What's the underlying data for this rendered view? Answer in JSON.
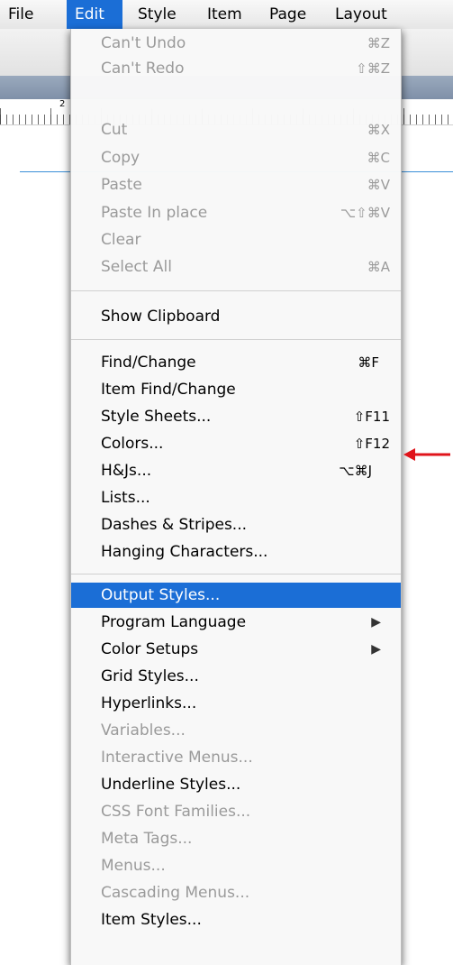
{
  "menubar": {
    "items": [
      {
        "label": "File",
        "active": false
      },
      {
        "label": "Edit",
        "active": true
      },
      {
        "label": "Style",
        "active": false
      },
      {
        "label": "Item",
        "active": false
      },
      {
        "label": "Page",
        "active": false
      },
      {
        "label": "Layout",
        "active": false
      }
    ]
  },
  "ruler": {
    "number": "2"
  },
  "edit_menu": {
    "items": [
      {
        "label": "Can't Undo",
        "shortcut": "⌘Z",
        "enabled": false
      },
      {
        "label": "Can't Redo",
        "shortcut": "⇧⌘Z",
        "enabled": false
      },
      {
        "label": "Cut",
        "shortcut": "⌘X",
        "enabled": false
      },
      {
        "label": "Copy",
        "shortcut": "⌘C",
        "enabled": false
      },
      {
        "label": "Paste",
        "shortcut": "⌘V",
        "enabled": false
      },
      {
        "label": "Paste In place",
        "shortcut": "⌥⇧⌘V",
        "enabled": false
      },
      {
        "label": "Clear",
        "shortcut": "",
        "enabled": false
      },
      {
        "label": "Select All",
        "shortcut": "⌘A",
        "enabled": false
      },
      {
        "label": "Show Clipboard",
        "shortcut": "",
        "enabled": true
      },
      {
        "label": "Find/Change",
        "shortcut": "⌘F",
        "enabled": true
      },
      {
        "label": "Item Find/Change",
        "shortcut": "",
        "enabled": true
      },
      {
        "label": "Style Sheets...",
        "shortcut": "⇧F11",
        "enabled": true
      },
      {
        "label": "Colors...",
        "shortcut": "⇧F12",
        "enabled": true
      },
      {
        "label": "H&Js...",
        "shortcut": "⌥⌘J",
        "enabled": true
      },
      {
        "label": "Lists...",
        "shortcut": "",
        "enabled": true
      },
      {
        "label": "Dashes & Stripes...",
        "shortcut": "",
        "enabled": true
      },
      {
        "label": "Hanging Characters...",
        "shortcut": "",
        "enabled": true
      },
      {
        "label": "Output Styles...",
        "shortcut": "",
        "enabled": true,
        "highlighted": true
      },
      {
        "label": "Program Language",
        "shortcut": "",
        "enabled": true,
        "submenu": true
      },
      {
        "label": "Color Setups",
        "shortcut": "",
        "enabled": true,
        "submenu": true
      },
      {
        "label": "Grid Styles...",
        "shortcut": "",
        "enabled": true
      },
      {
        "label": "Hyperlinks...",
        "shortcut": "",
        "enabled": true
      },
      {
        "label": "Variables...",
        "shortcut": "",
        "enabled": false
      },
      {
        "label": "Interactive Menus...",
        "shortcut": "",
        "enabled": false
      },
      {
        "label": "Underline Styles...",
        "shortcut": "",
        "enabled": true
      },
      {
        "label": "CSS Font Families...",
        "shortcut": "",
        "enabled": false
      },
      {
        "label": "Meta Tags...",
        "shortcut": "",
        "enabled": false
      },
      {
        "label": "Menus...",
        "shortcut": "",
        "enabled": false
      },
      {
        "label": "Cascading Menus...",
        "shortcut": "",
        "enabled": false
      },
      {
        "label": "Item Styles...",
        "shortcut": "",
        "enabled": true
      }
    ]
  },
  "icons": {
    "submenu": "chevron-right-icon",
    "annotation": "red-arrow-icon"
  },
  "colors": {
    "highlight": "#1b6ed6",
    "disabled_text": "#9a9a9a",
    "annotation_arrow": "#e0141b"
  }
}
